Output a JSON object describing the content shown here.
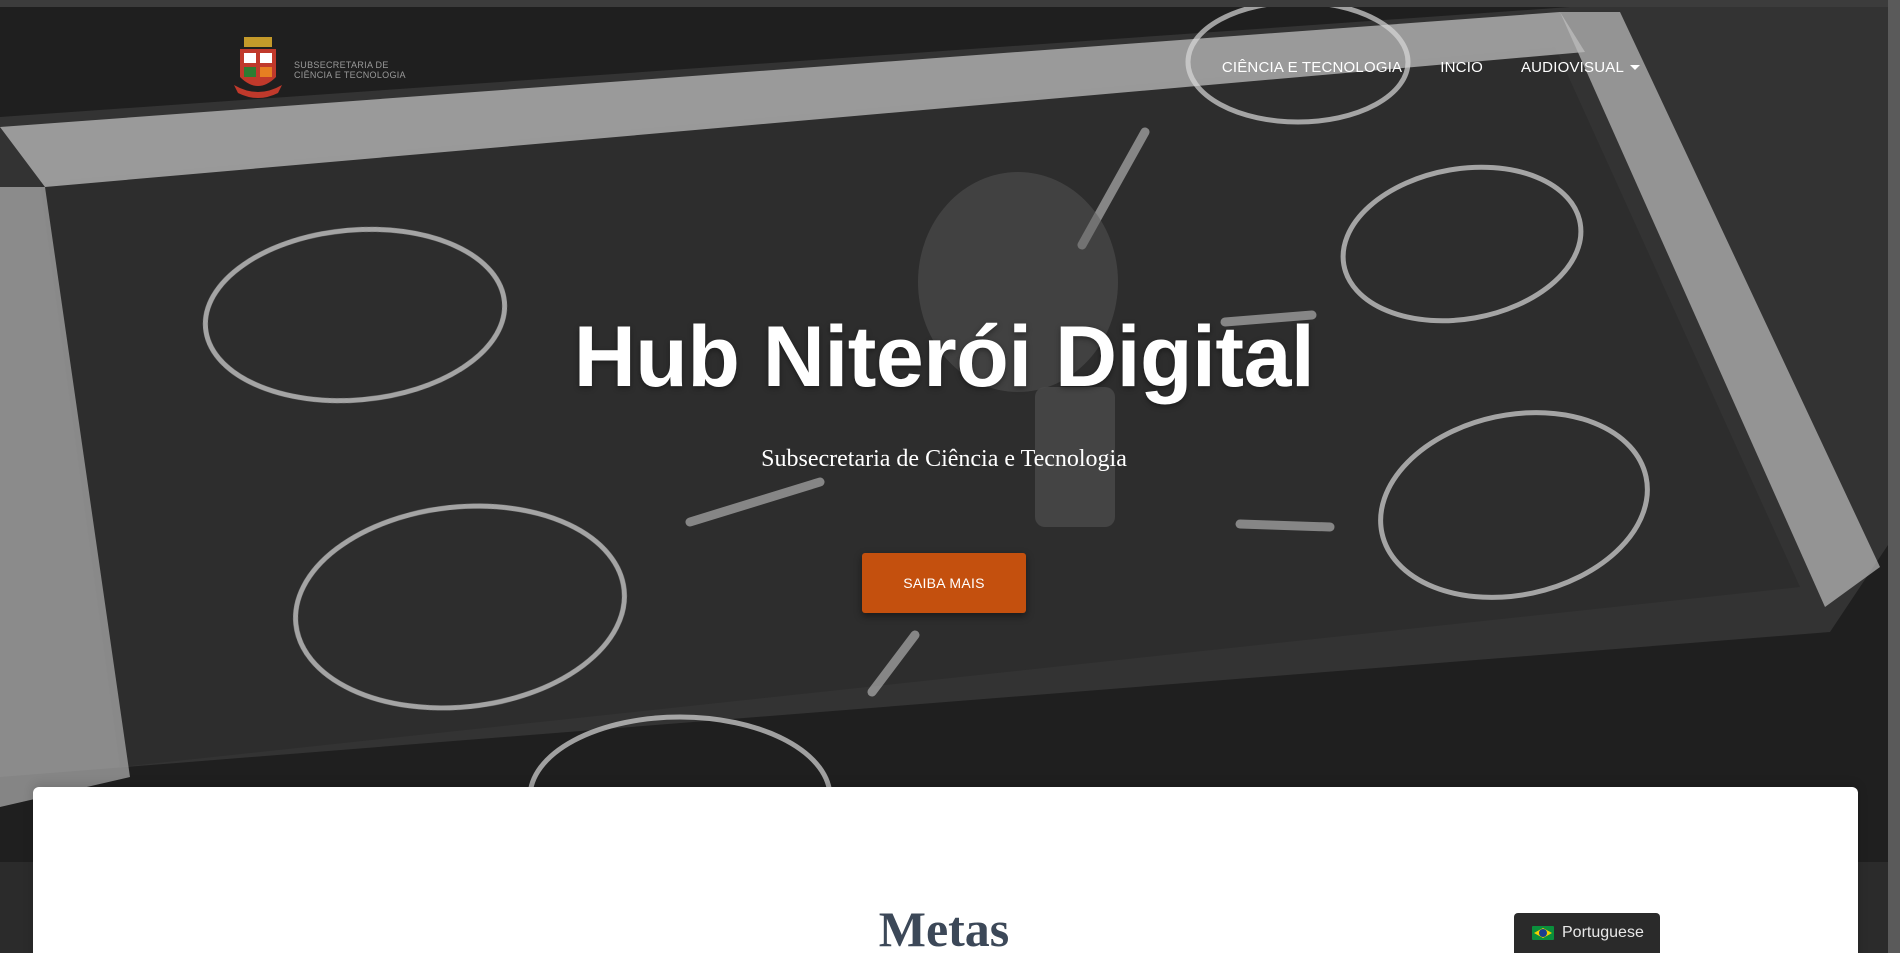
{
  "header": {
    "logo_text": "SUBSECRETARIA DE CIÊNCIA E TECNOLOGIA",
    "nav": [
      {
        "label": "CIÊNCIA E TECNOLOGIA"
      },
      {
        "label": "INCIO"
      },
      {
        "label": "AUDIOVISUAL"
      }
    ]
  },
  "hero": {
    "title": "Hub Niterói Digital",
    "subtitle": "Subsecretaria de Ciência e Tecnologia",
    "cta_label": "SAIBA MAIS"
  },
  "section": {
    "title": "Metas"
  },
  "language": {
    "label": "Portuguese",
    "flag_icon": "brazil-flag-icon"
  },
  "colors": {
    "accent": "#c4500e",
    "heading": "#3c4858"
  }
}
